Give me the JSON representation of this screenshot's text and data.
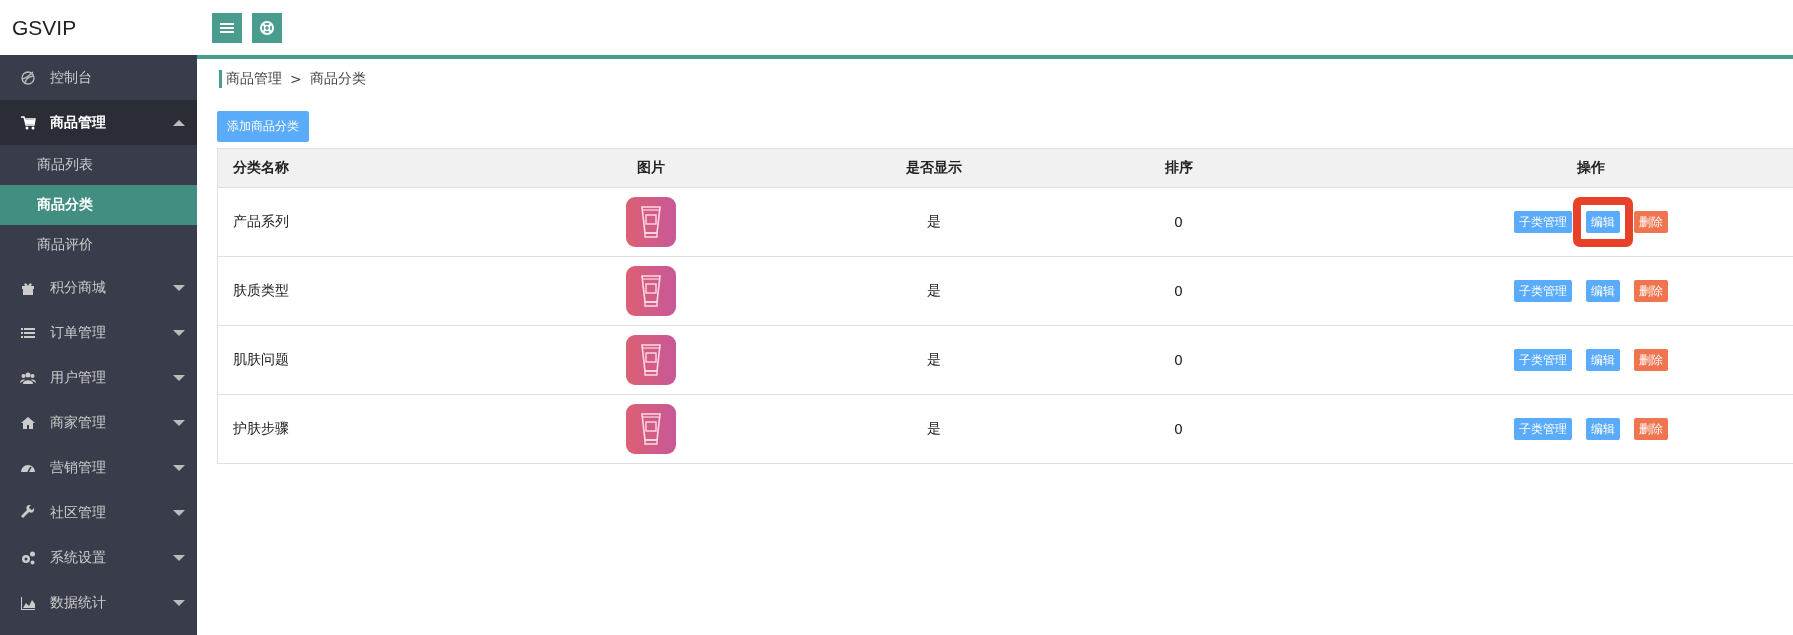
{
  "brand": "GSVIP",
  "sidebar": {
    "items": [
      {
        "label": "控制台",
        "kind": "link"
      },
      {
        "label": "商品管理",
        "kind": "group",
        "expanded": true,
        "children": [
          {
            "label": "商品列表",
            "selected": false
          },
          {
            "label": "商品分类",
            "selected": true
          },
          {
            "label": "商品评价",
            "selected": false
          }
        ]
      },
      {
        "label": "积分商城",
        "kind": "group",
        "expanded": false
      },
      {
        "label": "订单管理",
        "kind": "group",
        "expanded": false
      },
      {
        "label": "用户管理",
        "kind": "group",
        "expanded": false
      },
      {
        "label": "商家管理",
        "kind": "group",
        "expanded": false
      },
      {
        "label": "营销管理",
        "kind": "group",
        "expanded": false
      },
      {
        "label": "社区管理",
        "kind": "group",
        "expanded": false
      },
      {
        "label": "系统设置",
        "kind": "group",
        "expanded": false
      },
      {
        "label": "数据统计",
        "kind": "group",
        "expanded": false
      }
    ]
  },
  "breadcrumb": [
    "商品管理",
    "商品分类"
  ],
  "breadcrumb_separator": ">",
  "add_button": "添加商品分类",
  "table": {
    "columns": [
      "分类名称",
      "图片",
      "是否显示",
      "排序",
      "操作"
    ],
    "rows": [
      {
        "name": "产品系列",
        "visible": "是",
        "sort": "0",
        "actions": [
          "子类管理",
          "编辑",
          "删除"
        ],
        "highlighted": true
      },
      {
        "name": "肤质类型",
        "visible": "是",
        "sort": "0",
        "actions": [
          "子类管理",
          "编辑",
          "删除"
        ],
        "highlighted": false
      },
      {
        "name": "肌肤问题",
        "visible": "是",
        "sort": "0",
        "actions": [
          "子类管理",
          "编辑",
          "删除"
        ],
        "highlighted": false
      },
      {
        "name": "护肤步骤",
        "visible": "是",
        "sort": "0",
        "actions": [
          "子类管理",
          "编辑",
          "删除"
        ],
        "highlighted": false
      }
    ]
  }
}
